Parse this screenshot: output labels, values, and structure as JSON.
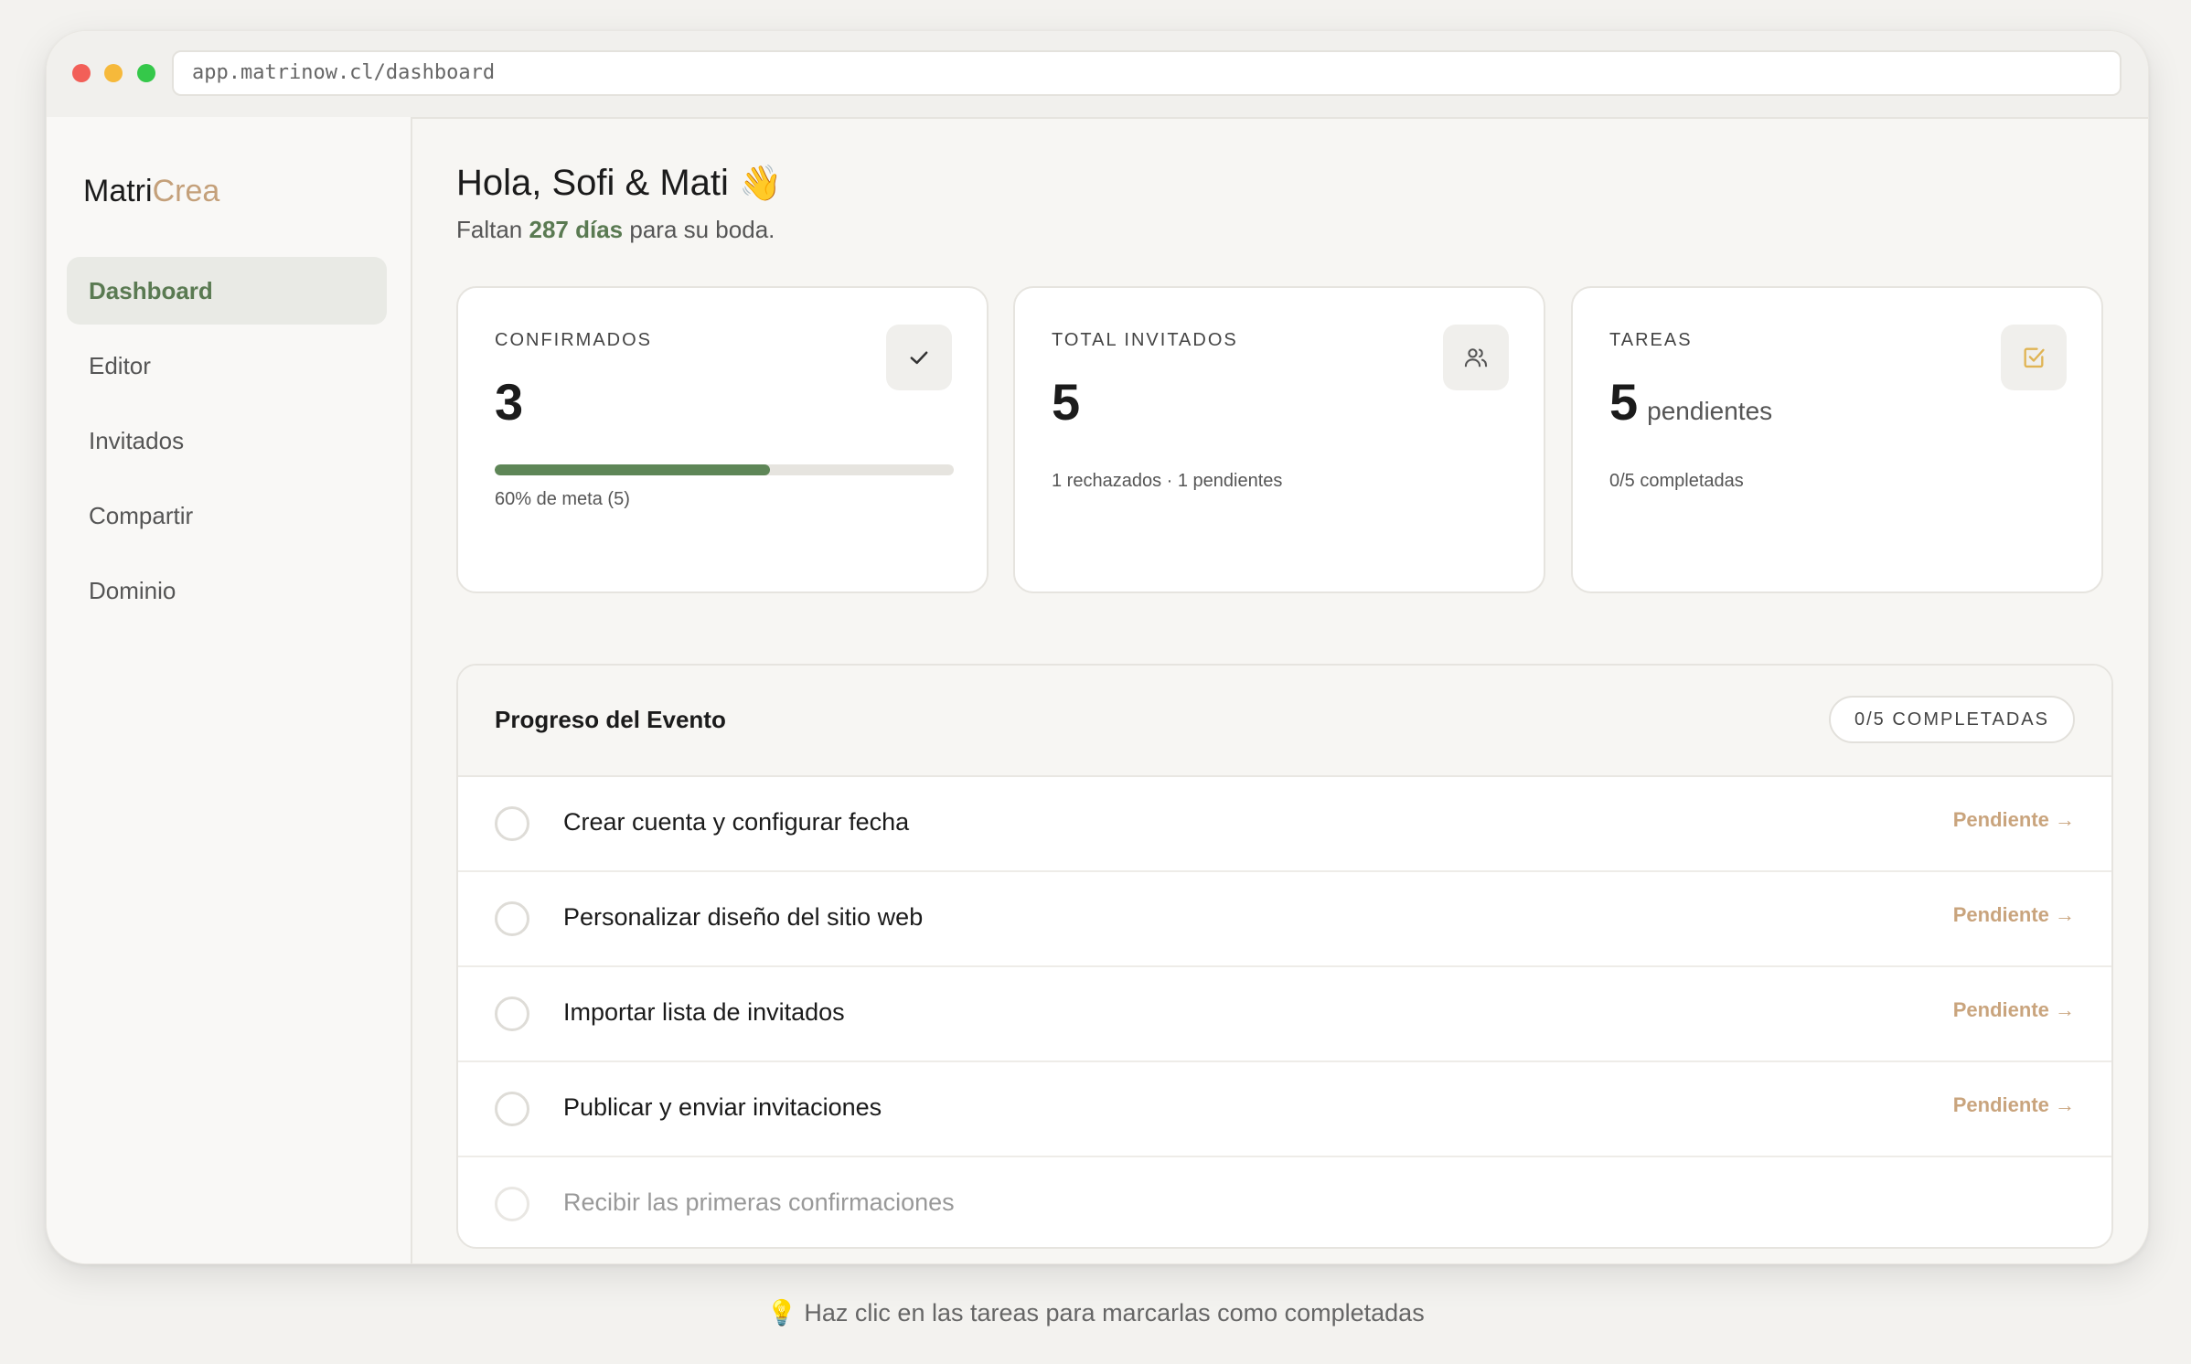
{
  "browser": {
    "url": "app.matrinow.cl/dashboard"
  },
  "sidebar": {
    "logo_main": "Matri",
    "logo_accent": "Crea",
    "items": [
      {
        "label": "Dashboard",
        "active": true
      },
      {
        "label": "Editor"
      },
      {
        "label": "Invitados"
      },
      {
        "label": "Compartir"
      },
      {
        "label": "Dominio"
      }
    ]
  },
  "header": {
    "greeting": "Hola, Sofi & Mati",
    "wave": "👋",
    "sub_prefix": "Faltan ",
    "days": "287 días",
    "sub_suffix": " para su boda."
  },
  "cards": {
    "confirmados": {
      "label": "CONFIRMADOS",
      "value": "3",
      "progress": 0.6,
      "meta": "60% de meta (5)",
      "icon": "check-icon"
    },
    "invitados": {
      "label": "TOTAL INVITADOS",
      "value": "5",
      "meta": "1 rechazados · 1 pendientes",
      "icon": "users-icon"
    },
    "tareas": {
      "label": "TAREAS",
      "value": "5",
      "unit": "pendientes",
      "meta": "0/5 completadas",
      "icon": "checkbox-icon",
      "accent": "#e0b454"
    }
  },
  "progress_panel": {
    "title": "Progreso del Evento",
    "badge": "0/5 COMPLETADAS",
    "tasks": [
      {
        "label": "Crear cuenta y configurar fecha",
        "status": "Pendiente →"
      },
      {
        "label": "Personalizar diseño del sitio web",
        "status": "Pendiente →"
      },
      {
        "label": "Importar lista de invitados",
        "status": "Pendiente →"
      },
      {
        "label": "Publicar y enviar invitaciones",
        "status": "Pendiente →"
      },
      {
        "label": "Recibir las primeras confirmaciones",
        "status": ""
      }
    ]
  },
  "footer": {
    "hint": "💡 Haz clic en las tareas para marcarlas como completadas"
  },
  "colors": {
    "green": "#5e8657",
    "accent": "#c4a07a",
    "status": "#c9a47d"
  }
}
